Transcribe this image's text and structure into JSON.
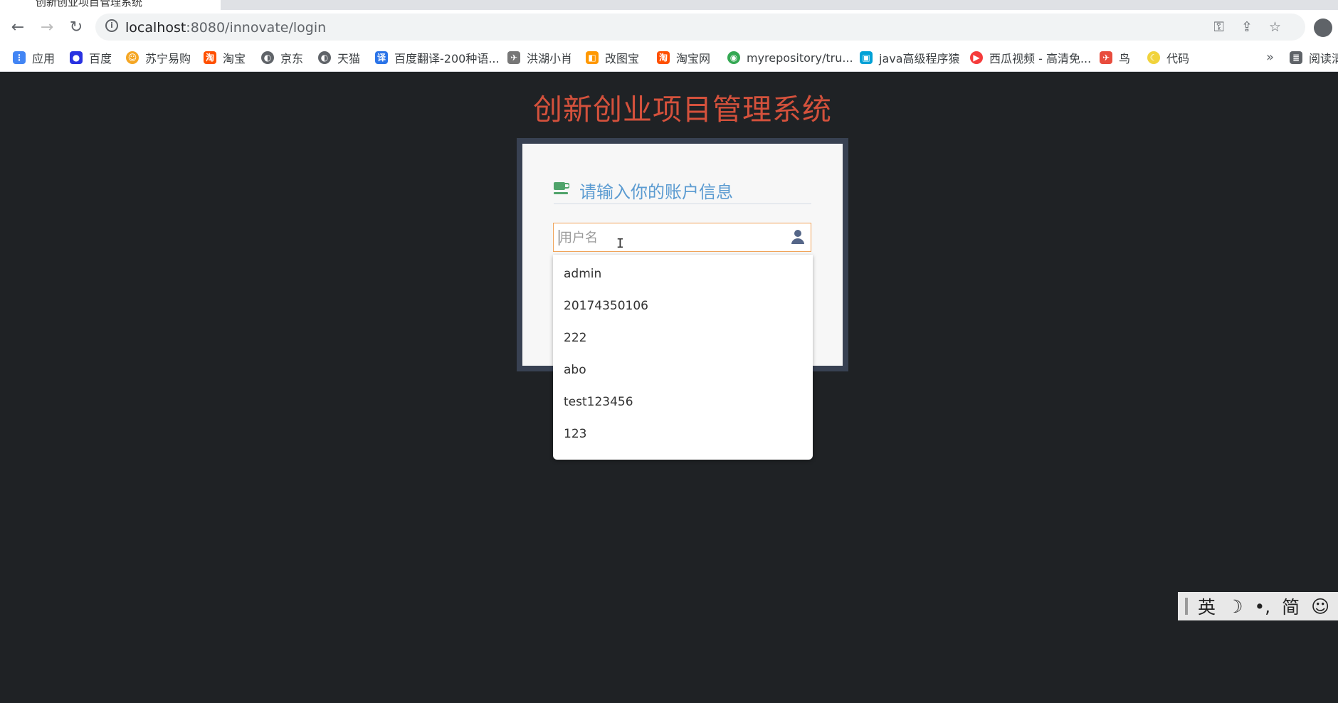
{
  "browser": {
    "tab_title": "创新创业项目管理系统",
    "url_host": "localhost",
    "url_rest": ":8080/innovate/login",
    "bookmarks": [
      {
        "label": "应用",
        "icon": "apps-grid-icon",
        "color": "#4285f4"
      },
      {
        "label": "百度",
        "icon": "baidu-paw-icon",
        "color": "#2932e1"
      },
      {
        "label": "苏宁易购",
        "icon": "suning-icon",
        "color": "#f5a623"
      },
      {
        "label": "淘宝",
        "icon": "taobao-icon",
        "color": "#ff5000"
      },
      {
        "label": "京东",
        "icon": "globe-icon",
        "color": "#5f6368"
      },
      {
        "label": "天猫",
        "icon": "globe-icon",
        "color": "#5f6368"
      },
      {
        "label": "百度翻译-200种语...",
        "icon": "translate-icon",
        "color": "#2b74e8"
      },
      {
        "label": "洪湖小肖",
        "icon": "bird-icon",
        "color": "#777777"
      },
      {
        "label": "改图宝",
        "icon": "gaitubao-icon",
        "color": "#ff9800"
      },
      {
        "label": "淘宝网",
        "icon": "taobao-icon",
        "color": "#ff5000"
      },
      {
        "label": "myrepository/tru...",
        "icon": "chrome-icon",
        "color": "#34a853"
      },
      {
        "label": "java高级程序猿",
        "icon": "bilibili-icon",
        "color": "#00a1d6"
      },
      {
        "label": "西瓜视频 - 高清免...",
        "icon": "xigua-icon",
        "color": "#f53b3b"
      },
      {
        "label": "鸟",
        "icon": "bird-icon",
        "color": "#e84c3d"
      },
      {
        "label": "代码",
        "icon": "moon-icon",
        "color": "#f1d33c"
      }
    ],
    "more_label": "»",
    "reading_list_label": "阅读清"
  },
  "page": {
    "title": "创新创业项目管理系统",
    "header": "请输入你的账户信息",
    "username_placeholder": "用户名",
    "autocomplete": [
      "admin",
      "20174350106",
      "222",
      "abo",
      "test123456",
      "123"
    ]
  },
  "ime": {
    "lang": "英",
    "punct": "•,",
    "script": "简"
  },
  "colors": {
    "title": "#d4513c",
    "header": "#5b9bd1",
    "cup": "#4fa36a",
    "input_border": "#f0a359",
    "box_border": "#384152",
    "background": "#1f2225"
  }
}
